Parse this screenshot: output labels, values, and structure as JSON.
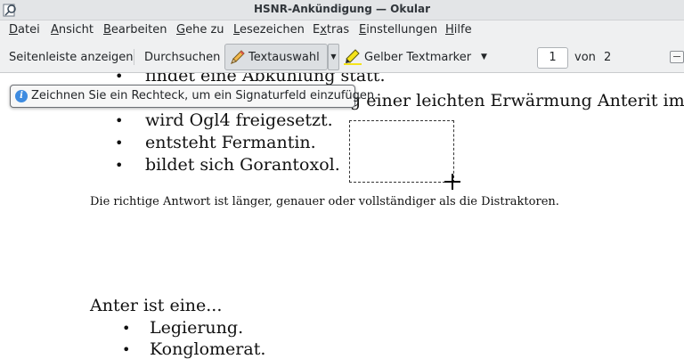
{
  "window": {
    "title": "HSNR-Ankündigung — Okular"
  },
  "menu": [
    {
      "pre": "",
      "u": "D",
      "post": "atei"
    },
    {
      "pre": "",
      "u": "A",
      "post": "nsicht"
    },
    {
      "pre": "",
      "u": "B",
      "post": "earbeiten"
    },
    {
      "pre": "",
      "u": "G",
      "post": "ehe zu"
    },
    {
      "pre": "",
      "u": "L",
      "post": "esezeichen"
    },
    {
      "pre": "E",
      "u": "x",
      "post": "tras"
    },
    {
      "pre": "",
      "u": "E",
      "post": "instellungen"
    },
    {
      "pre": "",
      "u": "H",
      "post": "ilfe"
    }
  ],
  "toolbar": {
    "sidebar_label": "Seitenleiste anzeigen",
    "browse_label": "Durchsuchen",
    "text_select_label": "Textauswahl",
    "marker_label": "Gelber Textmarker",
    "page_value": "1",
    "of_label": "von",
    "page_total": "2"
  },
  "tooltip": {
    "text": "Zeichnen Sie ein Rechteck, um ein Signaturfeld einzufügen."
  },
  "document": {
    "partial_top": "findet eine Abkühlung statt.",
    "partial_right": "g einer leichten Erwärmung Anterit im pH-Be",
    "bullets1": [
      "wird Ogl4 freigesetzt.",
      "entsteht Fermantin.",
      "bildet sich Gorantoxol."
    ],
    "note": "Die richtige Antwort ist länger, genauer oder vollständiger als die Distraktoren.",
    "question": "Anter ist eine...",
    "bullets2": [
      "Legierung.",
      "Konglomerat."
    ],
    "bullet_char": "•"
  }
}
